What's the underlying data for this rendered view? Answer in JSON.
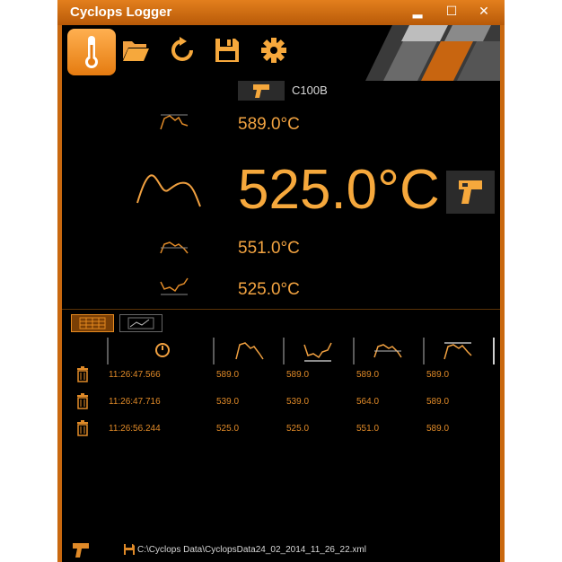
{
  "window": {
    "title": "Cyclops Logger",
    "min_glyph": "▂",
    "max_glyph": "☐",
    "close_glyph": "✕"
  },
  "toolbar": {
    "items": [
      {
        "name": "thermometer-icon",
        "active": true
      },
      {
        "name": "folder-open-icon",
        "active": false
      },
      {
        "name": "refresh-icon",
        "active": false
      },
      {
        "name": "save-icon",
        "active": false
      },
      {
        "name": "gear-icon",
        "active": false
      }
    ]
  },
  "device": {
    "name": "C100B"
  },
  "readings": {
    "max": "589.0°C",
    "current": "525.0°C",
    "average": "551.0°C",
    "min": "525.0°C"
  },
  "table": {
    "headers": [
      "time",
      "current",
      "max",
      "average",
      "min"
    ],
    "rows": [
      {
        "time": "11:26:47.566",
        "current": "589.0",
        "max": "589.0",
        "average": "589.0",
        "min": "589.0"
      },
      {
        "time": "11:26:47.716",
        "current": "539.0",
        "max": "539.0",
        "average": "564.0",
        "min": "589.0"
      },
      {
        "time": "11:26:56.244",
        "current": "525.0",
        "max": "525.0",
        "average": "551.0",
        "min": "589.0"
      }
    ]
  },
  "status": {
    "file_path": "C:\\Cyclops Data\\CyclopsData24_02_2014_11_26_22.xml"
  },
  "colors": {
    "accent": "#f6a83c",
    "frame": "#c9680f",
    "background": "#000000"
  }
}
